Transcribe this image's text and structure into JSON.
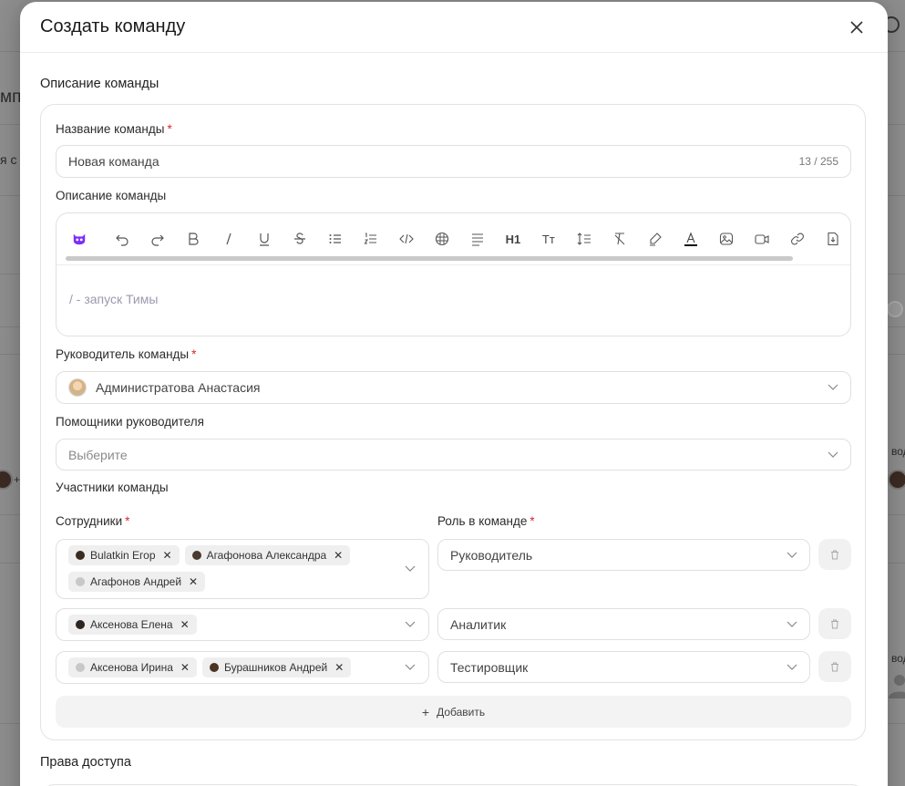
{
  "background": {
    "fragment_1": "мп",
    "fragment_2": "я с",
    "fragment_3": "вод",
    "fragment_4": "вод",
    "fragment_5": "+"
  },
  "modal": {
    "title": "Создать команду",
    "section_description": "Описание команды",
    "section_access": "Права доступа",
    "fields": {
      "team_name_label": "Название команды",
      "team_name_value": "Новая команда",
      "team_name_counter": "13 / 255",
      "description_label": "Описание команды",
      "description_placeholder": "/ - запуск Тимы",
      "leader_label": "Руководитель команды",
      "leader_value": "Администратова Анастасия",
      "assistants_label": "Помощники руководителя",
      "assistants_placeholder": "Выберите",
      "members_label": "Участники команды",
      "employees_label": "Сотрудники",
      "role_label": "Роль в команде",
      "required_mark": "*"
    },
    "toolbar": {
      "h1": "H1",
      "text_size": "Tт"
    },
    "rows": [
      {
        "chips": [
          "Bulatkin Егор",
          "Агафонова Александра",
          "Агафонов Андрей"
        ],
        "role": "Руководитель"
      },
      {
        "chips": [
          "Аксенова Елена"
        ],
        "role": "Аналитик"
      },
      {
        "chips": [
          "Аксенова Ирина",
          "Бурашников Андрей"
        ],
        "role": "Тестировщик"
      }
    ],
    "add_label": "Добавить",
    "chip_remove": "✕",
    "add_plus": "+"
  },
  "colors": {
    "required": "#d62828",
    "brand_icon": "#7b2ff7"
  }
}
